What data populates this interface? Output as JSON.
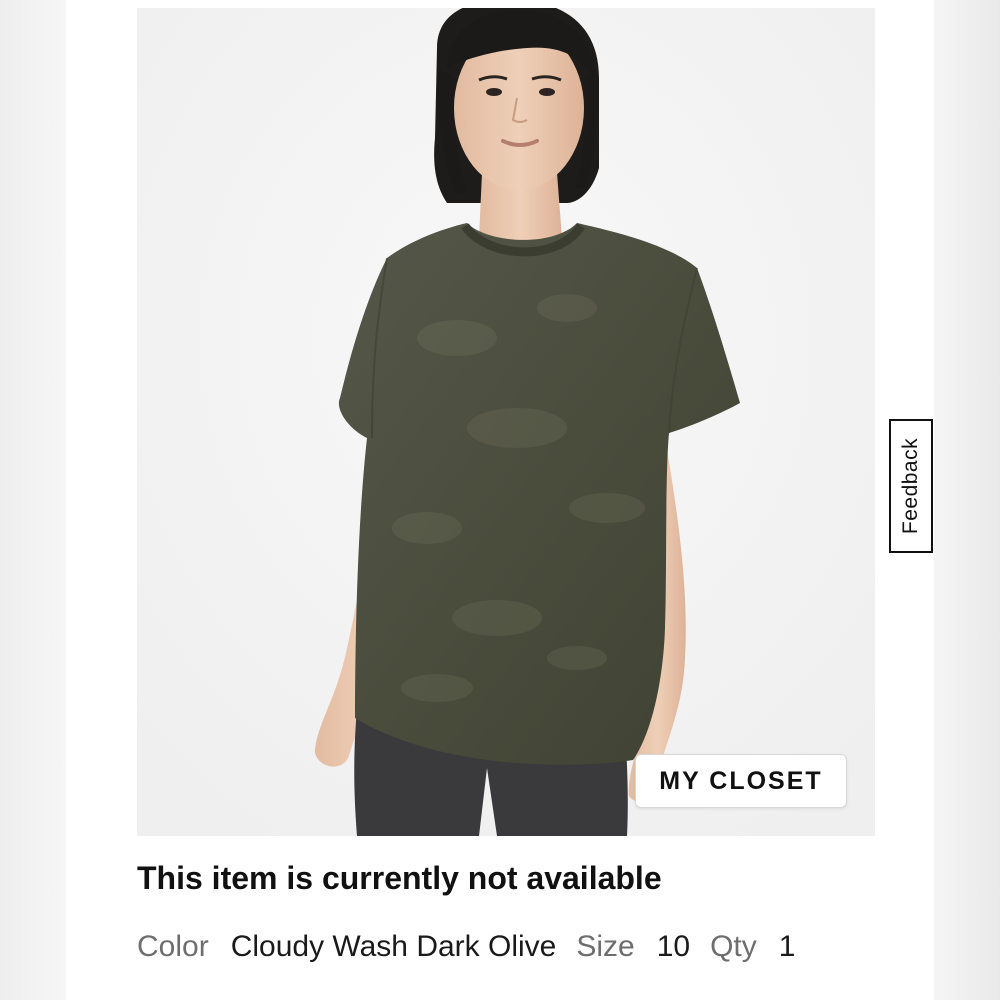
{
  "product": {
    "image_alt": "Model wearing olive cloudy wash t-shirt",
    "status_text": "This item is currently not available",
    "color_label": "Color",
    "color_value": "Cloudy Wash Dark Olive",
    "size_label": "Size",
    "size_value": "10",
    "qty_label": "Qty",
    "qty_value": "1"
  },
  "actions": {
    "closet_label": "MY CLOSET",
    "feedback_label": "Feedback"
  },
  "colors": {
    "shirt": "#4a4b3a",
    "pants": "#3a393b",
    "skin": "#e8c6ad",
    "hair": "#1c1a19",
    "text": "#111111",
    "muted": "#6e6e6e"
  }
}
